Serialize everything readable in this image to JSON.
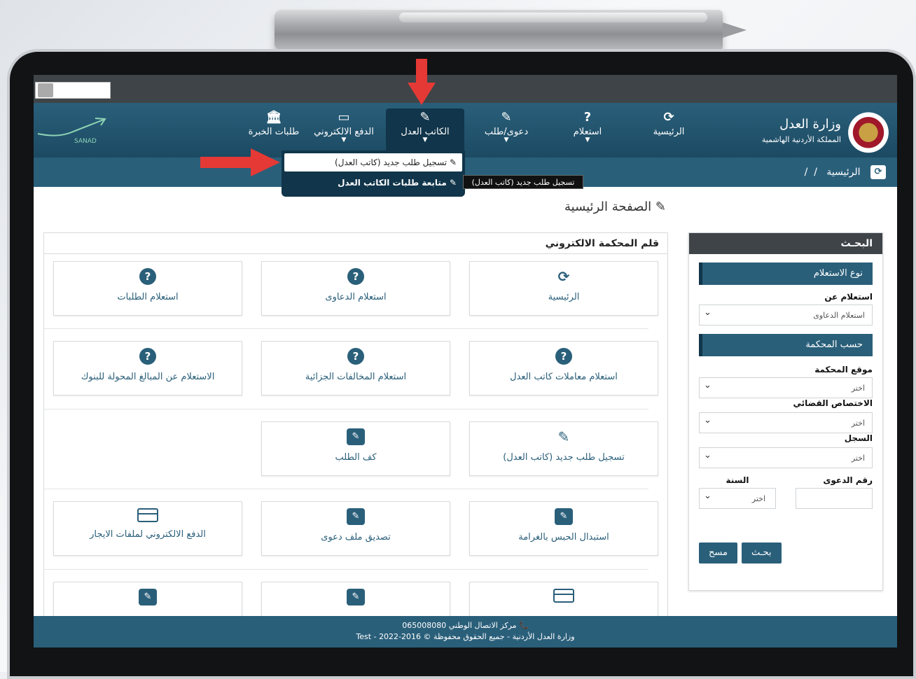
{
  "nav": {
    "home": "الرئيسية",
    "inquiry": "استعلام",
    "lawsuit": "دعوى/طلب",
    "notary": "الكاتب العدل",
    "epay": "الدفع الالكتروني",
    "experts": "طلبات الخبرة"
  },
  "logo": {
    "title": "وزارة العدل",
    "subtitle": "المملكة الأردنية الهاشمية",
    "sanad": "SANAD"
  },
  "dropdown": {
    "item1": "تسجيل طلب جديد (كاتب العدل)",
    "item2": "متابعة طلبات الكاتب العدل"
  },
  "tooltip": "تسجيل طلب جديد (كاتب العدل)",
  "breadcrumb": {
    "home": "الرئيسية",
    "sep": "/",
    "sep2": "/"
  },
  "page_title": "الصفحة الرئيسية",
  "sidebar": {
    "header": "البحـث",
    "type_bar": "نوع الاستعلام",
    "inquiry_label": "استعلام عن",
    "inquiry_value": "استعلام الدعاوى",
    "court_bar": "حسب المحكمة",
    "court_site_label": "موقع المحكمة",
    "court_site_value": "اختر",
    "jurisdiction_label": "الاختصاص القضائي",
    "jurisdiction_value": "اختر",
    "register_label": "السجل",
    "register_value": "اختر",
    "case_no_label": "رقم الدعوى",
    "year_label": "السنة",
    "year_value": "اختر",
    "search_btn": "بحـث",
    "clear_btn": "مسح"
  },
  "panel": {
    "header": "قلم المحكمة الالكتروني",
    "tiles": [
      "الرئيسية",
      "استعلام الدعاوى",
      "استعلام الطلبات",
      "استعلام معاملات كاتب العدل",
      "استعلام المخالفات الجزائية",
      "الاستعلام عن المبالغ المحولة للبنوك",
      "تسجيل طلب جديد (كاتب العدل)",
      "كف الطلب",
      "استبدال الحبس بالغرامة",
      "تصديق ملف دعوى",
      "الدفع الالكتروني لملفات الايجار"
    ]
  },
  "footer": {
    "line1": "مركز الاتصال الوطني 065008080",
    "line2": "وزارة العدل الأردنية - جميع الحقوق محفوظة © 2016-2022 - Test"
  }
}
